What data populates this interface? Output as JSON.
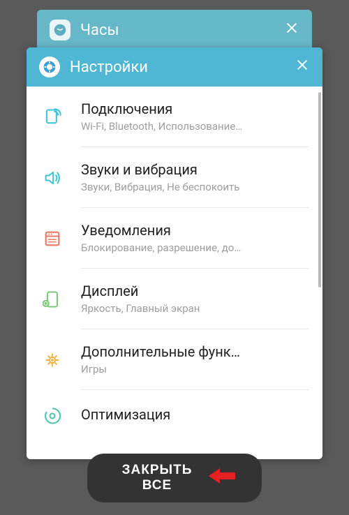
{
  "back_card": {
    "title": "Часы"
  },
  "front_card": {
    "title": "Настройки"
  },
  "settings": [
    {
      "title": "Подключения",
      "subtitle": "Wi-Fi, Bluetooth, Использование…",
      "icon": "connections",
      "color": "#43c5d6"
    },
    {
      "title": "Звуки и вибрация",
      "subtitle": "Звуки, Вибрация, Не беспокоить",
      "icon": "sound",
      "color": "#43c5d6"
    },
    {
      "title": "Уведомления",
      "subtitle": "Блокирование, разрешение, до…",
      "icon": "notifications",
      "color": "#ee7764"
    },
    {
      "title": "Дисплей",
      "subtitle": "Яркость, Главный экран",
      "icon": "display",
      "color": "#7fc67f"
    },
    {
      "title": "Дополнительные функ…",
      "subtitle": "Игры",
      "icon": "advanced",
      "color": "#f0b64c"
    },
    {
      "title": "Оптимизация",
      "subtitle": "",
      "icon": "optimization",
      "color": "#4fc6b0"
    }
  ],
  "close_all_label": "ЗАКРЫТЬ ВСЕ"
}
